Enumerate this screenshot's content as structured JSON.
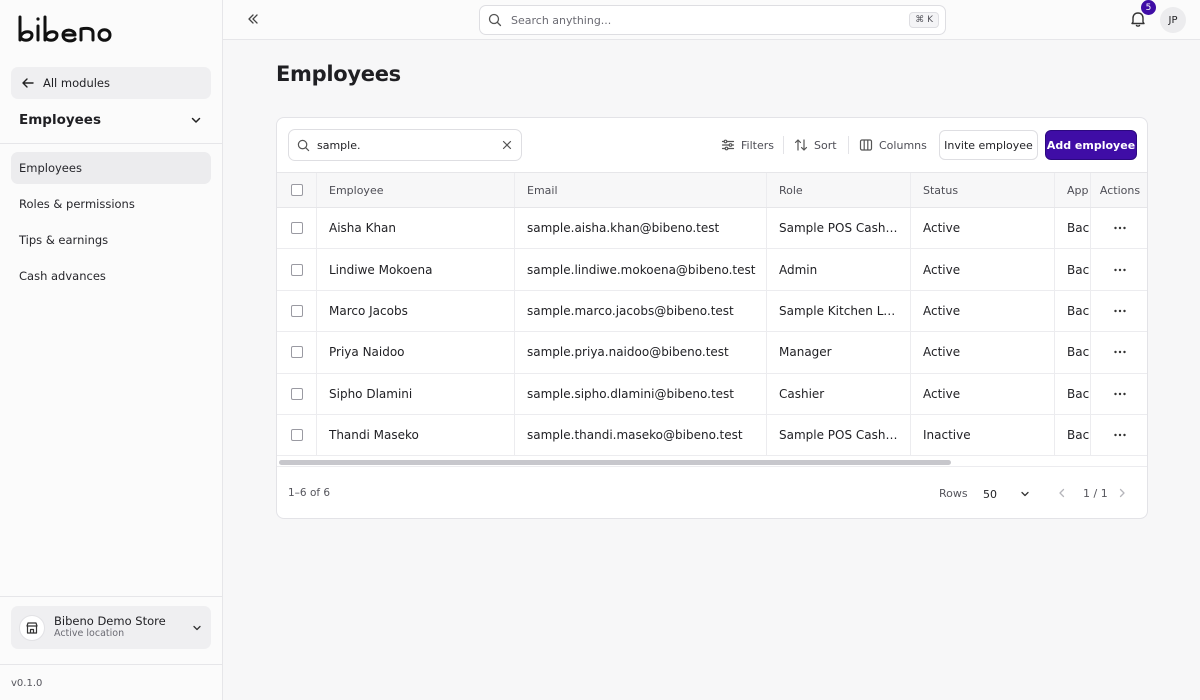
{
  "brand": {
    "logo_text": "bibeno"
  },
  "sidebar": {
    "back_label": "All modules",
    "module": "Employees",
    "items": [
      {
        "label": "Employees",
        "active": true
      },
      {
        "label": "Roles & permissions"
      },
      {
        "label": "Tips & earnings"
      },
      {
        "label": "Cash advances"
      }
    ],
    "store": {
      "name": "Bibeno Demo Store",
      "subtitle": "Active location"
    },
    "version": "v0.1.0"
  },
  "topbar": {
    "search_placeholder": "Search anything...",
    "shortcut": "⌘ K",
    "notifications": "5",
    "user_initials": "JP"
  },
  "page": {
    "title": "Employees"
  },
  "toolbar": {
    "search_value": "sample.",
    "filters": "Filters",
    "sort": "Sort",
    "columns": "Columns",
    "invite": "Invite employee",
    "add": "Add employee"
  },
  "table": {
    "headers": {
      "employee": "Employee",
      "email": "Email",
      "role": "Role",
      "status": "Status",
      "app": "App",
      "actions": "Actions"
    },
    "rows": [
      {
        "employee": "Aisha Khan",
        "email": "sample.aisha.khan@bibeno.test",
        "role": "Sample POS Cashier",
        "status": "Active",
        "app": "Bac"
      },
      {
        "employee": "Lindiwe Mokoena",
        "email": "sample.lindiwe.mokoena@bibeno.test",
        "role": "Admin",
        "status": "Active",
        "app": "Bac"
      },
      {
        "employee": "Marco Jacobs",
        "email": "sample.marco.jacobs@bibeno.test",
        "role": "Sample Kitchen Lead",
        "status": "Active",
        "app": "Bac"
      },
      {
        "employee": "Priya Naidoo",
        "email": "sample.priya.naidoo@bibeno.test",
        "role": "Manager",
        "status": "Active",
        "app": "Bac"
      },
      {
        "employee": "Sipho Dlamini",
        "email": "sample.sipho.dlamini@bibeno.test",
        "role": "Cashier",
        "status": "Active",
        "app": "Bac"
      },
      {
        "employee": "Thandi Maseko",
        "email": "sample.thandi.maseko@bibeno.test",
        "role": "Sample POS Cashier",
        "status": "Inactive",
        "app": "Bac"
      }
    ]
  },
  "footer": {
    "count": "1–6 of 6",
    "rows_label": "Rows",
    "rows_value": "50",
    "page": "1 / 1"
  },
  "colors": {
    "primary": "#3f0da6"
  },
  "icons": {
    "back": "arrow-left-icon",
    "chevron": "chevron-down-icon",
    "store": "store-icon",
    "collapse": "chevrons-left-icon",
    "search": "search-icon",
    "bell": "bell-icon",
    "filters": "sliders-icon",
    "sort": "sort-icon",
    "columns": "columns-icon",
    "clear": "x-icon",
    "more": "more-horizontal-icon",
    "prev": "chevron-left-icon",
    "next": "chevron-right-icon"
  }
}
